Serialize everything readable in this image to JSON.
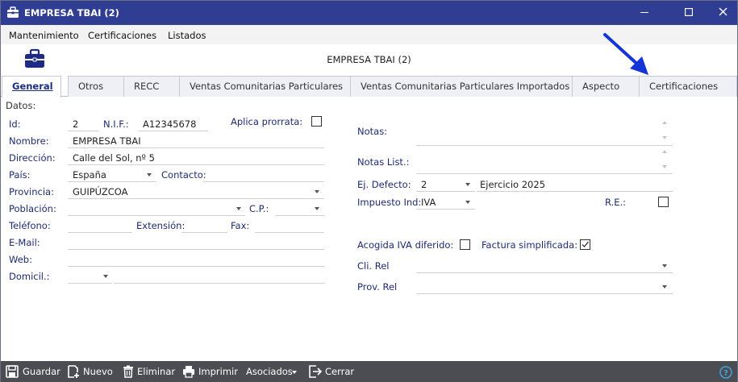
{
  "window": {
    "title": "EMPRESA TBAI (2)"
  },
  "menu": {
    "items": [
      "Mantenimiento",
      "Certificaciones",
      "Listados"
    ]
  },
  "header": {
    "title": "EMPRESA TBAI (2)"
  },
  "tabs": [
    "General",
    "Otros",
    "RECC",
    "Ventas Comunitarias Particulares",
    "Ventas Comunitarias Particulares Importados",
    "Aspecto",
    "Certificaciones"
  ],
  "form": {
    "section_label": "Datos:",
    "id_label": "Id:",
    "id_value": "2",
    "nif_label": "N.I.F.:",
    "nif_value": "A12345678",
    "prorrata_label": "Aplica prorrata:",
    "nombre_label": "Nombre:",
    "nombre_value": "EMPRESA TBAI",
    "direccion_label": "Dirección:",
    "direccion_value": "Calle del Sol, nº 5",
    "pais_label": "País:",
    "pais_value": "España",
    "contacto_label": "Contacto:",
    "provincia_label": "Provincia:",
    "provincia_value": "GUIPÚZCOA",
    "poblacion_label": "Población:",
    "cp_label": "C.P.:",
    "telefono_label": "Teléfono:",
    "extension_label": "Extensión:",
    "fax_label": "Fax:",
    "email_label": "E-Mail:",
    "web_label": "Web:",
    "domicil_label": "Domicil.:",
    "notas_label": "Notas:",
    "notas_list_label": "Notas List.:",
    "ej_defecto_label": "Ej. Defecto:",
    "ej_defecto_value": "2",
    "ej_defecto_desc": "Ejercicio 2025",
    "impuesto_label": "Impuesto Ind:",
    "impuesto_value": "IVA",
    "re_label": "R.E.:",
    "acogida_label": "Acogida IVA diferido:",
    "factura_label": "Factura simplificada:",
    "cli_rel_label": "Cli. Rel",
    "prov_rel_label": "Prov. Rel"
  },
  "checkboxes": {
    "aplica_prorrata": false,
    "re": false,
    "acogida_iva_diferido": false,
    "factura_simplificada": true
  },
  "toolbar": {
    "guardar": "Guardar",
    "nuevo": "Nuevo",
    "eliminar": "Eliminar",
    "imprimir": "Imprimir",
    "asociados": "Asociados",
    "cerrar": "Cerrar"
  },
  "colors": {
    "titlebar": "#2f3e92",
    "toolbar": "#4c4d52",
    "label": "#1e2b73",
    "arrow": "#1534d6"
  }
}
